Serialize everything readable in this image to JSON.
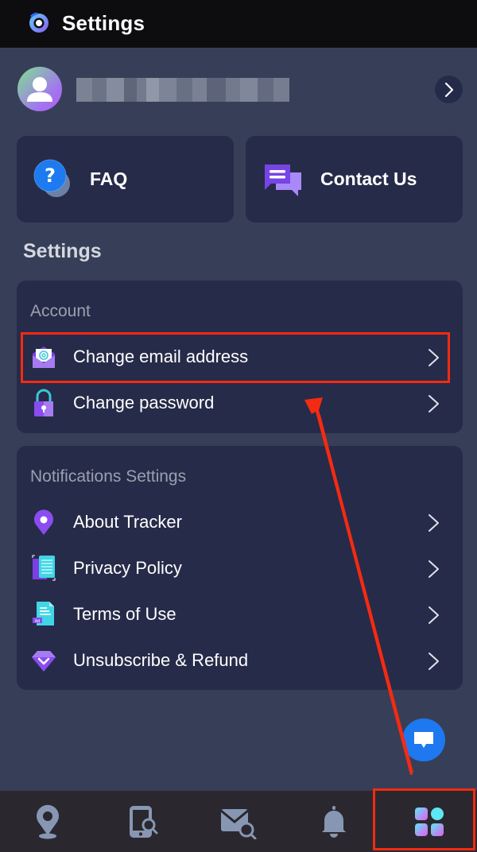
{
  "header": {
    "title": "Settings",
    "logo_icon": "app-logo-icon"
  },
  "profile": {
    "avatar_icon": "user-avatar-icon",
    "name_redacted": true,
    "arrow_icon": "chevron-right-icon"
  },
  "quick_actions": [
    {
      "label": "FAQ",
      "icon": "question-bubble-icon"
    },
    {
      "label": "Contact Us",
      "icon": "chat-bubbles-icon"
    }
  ],
  "section_title": "Settings",
  "groups": [
    {
      "header": "Account",
      "items": [
        {
          "label": "Change email address",
          "icon": "email-envelope-icon"
        },
        {
          "label": "Change password",
          "icon": "padlock-icon"
        }
      ]
    },
    {
      "header": "Notifications Settings",
      "items": [
        {
          "label": "About Tracker",
          "icon": "location-pin-icon"
        },
        {
          "label": "Privacy Policy",
          "icon": "document-copy-icon"
        },
        {
          "label": "Terms of Use",
          "icon": "terms-document-icon"
        },
        {
          "label": "Unsubscribe & Refund",
          "icon": "diamond-icon"
        }
      ]
    }
  ],
  "chat_fab": {
    "icon": "chat-message-icon"
  },
  "bottom_nav": [
    {
      "name": "location",
      "icon": "map-pin-icon",
      "active": false
    },
    {
      "name": "phone-search",
      "icon": "phone-search-icon",
      "active": false
    },
    {
      "name": "mail-search",
      "icon": "mail-search-icon",
      "active": false
    },
    {
      "name": "notifications",
      "icon": "bell-icon",
      "active": false
    },
    {
      "name": "more",
      "icon": "apps-grid-icon",
      "active": true
    }
  ],
  "colors": {
    "background": "#363f57",
    "card": "#262b49",
    "topbar": "#0d0d0f",
    "bottom_nav": "#2a282e",
    "accent_purple": "#8a4cf0",
    "accent_cyan": "#40d6e6",
    "fab_blue": "#1e78f0",
    "annotation_red": "#f52a12"
  },
  "annotations": {
    "highlight_target": "Change email address",
    "highlight_nav": "more"
  }
}
